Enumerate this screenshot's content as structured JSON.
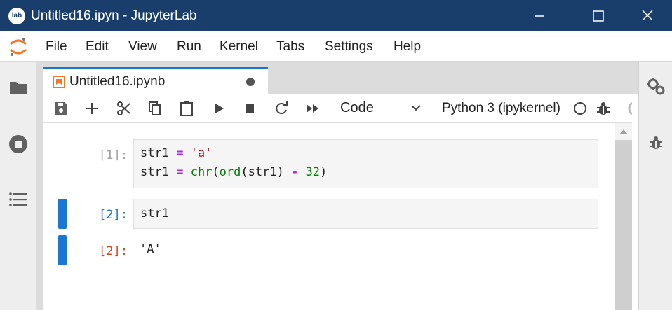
{
  "window": {
    "app_icon_text": "lab",
    "title": "Untitled16.ipyn - JupyterLab"
  },
  "menu": {
    "items": [
      "File",
      "Edit",
      "View",
      "Run",
      "Kernel",
      "Tabs",
      "Settings",
      "Help"
    ]
  },
  "tab": {
    "label": "Untitled16.ipynb"
  },
  "toolbar": {
    "cell_type": "Code",
    "kernel": "Python 3 (ipykernel)"
  },
  "cells": [
    {
      "prompt": "[1]:",
      "lines": [
        [
          "str1",
          " ",
          "=",
          " ",
          "'a'"
        ],
        [
          "str1",
          " ",
          "=",
          " ",
          "chr",
          "(",
          "ord",
          "(str1)",
          " ",
          "-",
          " ",
          "32",
          ")"
        ]
      ]
    },
    {
      "prompt": "[2]:",
      "code": "str1"
    },
    {
      "prompt": "[2]:",
      "output": "'A'"
    }
  ],
  "colors": {
    "title_bar": "#1a3e6b",
    "accent": "#1976d2",
    "output_prompt": "#d84315",
    "input_prompt_active": "#1976d2"
  }
}
